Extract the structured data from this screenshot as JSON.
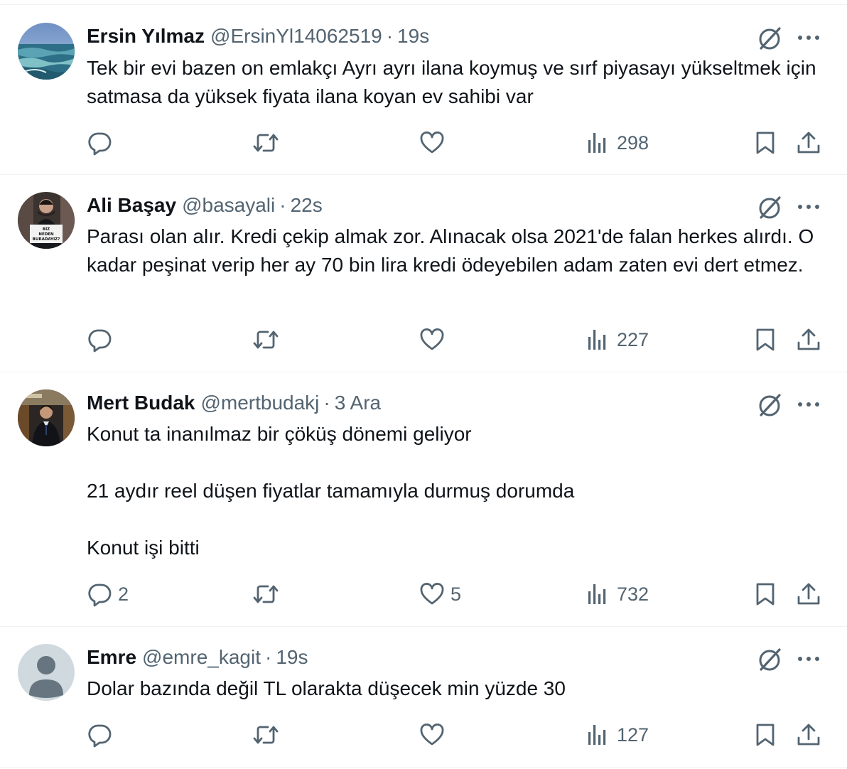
{
  "tweets": [
    {
      "name": "Ersin Yılmaz",
      "handle": "@ErsinYl14062519",
      "time": "19s",
      "lines": [
        "Tek bir evi bazen on emlakçı Ayrı ayrı ilana koymuş ve sırf piyasayı yükseltmek için satmasa da yüksek fiyata ilana koyan ev sahibi var"
      ],
      "replies": "",
      "likes": "",
      "views": "298"
    },
    {
      "name": "Ali Başay",
      "handle": "@basayali",
      "time": "22s",
      "lines": [
        "Parası olan alır. Kredi çekip almak zor. Alınacak olsa 2021'de falan herkes alırdı. O kadar peşinat verip her ay 70 bin lira kredi ödeyebilen adam zaten evi dert etmez."
      ],
      "avatar_sign_text": "BİZ NEDEN BURADAYIZ?",
      "replies": "",
      "likes": "",
      "views": "227"
    },
    {
      "name": "Mert Budak",
      "handle": "@mertbudakj",
      "time": "3 Ara",
      "lines": [
        "Konut ta inanılmaz bir çöküş dönemi geliyor",
        "21 aydır reel düşen fiyatlar tamamıyla durmuş dorumda",
        "Konut işi bitti"
      ],
      "replies": "2",
      "likes": "5",
      "views": "732"
    },
    {
      "name": "Emre",
      "handle": "@emre_kagit",
      "time": "19s",
      "lines": [
        "Dolar bazında değil TL olarakta düşecek min yüzde 30"
      ],
      "replies": "",
      "likes": "",
      "views": "127"
    }
  ],
  "icons": {
    "reply": "reply-icon",
    "retweet": "retweet-icon",
    "like": "like-icon",
    "views": "views-icon",
    "bookmark": "bookmark-icon",
    "share": "share-icon",
    "grok": "grok-icon",
    "more": "more-icon"
  },
  "colors": {
    "text": "#0f1419",
    "secondary": "#536471",
    "divider": "#eff3f4"
  }
}
